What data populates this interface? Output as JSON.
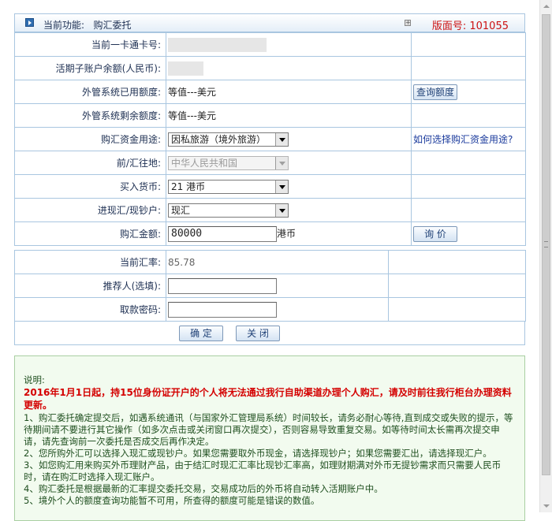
{
  "header": {
    "function_label": "当前功能:",
    "function_name": "购汇委托",
    "page_number_label": "版面号:",
    "page_number": "101055"
  },
  "form": {
    "card_no_label": "当前一卡通卡号:",
    "balance_label": "活期子账户余额(人民币):",
    "used_quota_label": "外管系统已用额度:",
    "used_quota_value": "等值---美元",
    "query_quota_button": "查询额度",
    "remaining_quota_label": "外管系统剩余额度:",
    "remaining_quota_value": "等值---美元",
    "purpose_label": "购汇资金用途:",
    "purpose_value": "因私旅游（境外旅游）",
    "purpose_help_link": "如何选择购汇资金用途?",
    "destination_label": "前/汇往地:",
    "destination_value": "中华人民共和国",
    "currency_label": "买入货币:",
    "currency_value": "21 港币",
    "cash_type_label": "进现汇/现钞户:",
    "cash_type_value": "现汇",
    "amount_label": "购汇金额:",
    "amount_value": "80000",
    "amount_unit": "港币",
    "price_button": "询 价",
    "rate_label": "当前汇率:",
    "rate_value": "85.78",
    "referrer_label": "推荐人(选填):",
    "referrer_value": "",
    "password_label": "取款密码:",
    "password_value": "",
    "confirm_button": "确 定",
    "close_button": "关 闭"
  },
  "notes": {
    "title": "说明:",
    "alert": "2016年1月1日起，持15位身份证开户的个人将无法通过我行自助渠道办理个人购汇，请及时前往我行柜台办理资料更新。",
    "items": [
      "1、购汇委托确定提交后，如遇系统通讯（与国家外汇管理局系统）时间较长，请务必耐心等待,直到成交或失败的提示，等待期间请不要进行其它操作（如多次点击或关闭窗口再次提交），否则容易导致重复交易。如等待时间太长需再次提交申请，请先查询前一次委托是否成交后再作决定。",
      "2、您所购外汇可以选择入现汇或现钞户。如果您需要取外币现金，请选择现钞户；如果您需要汇出，请选择现汇户。",
      "3、如您购汇用来购买外币理财产品，由于结汇时现汇汇率比现钞汇率高，如理财期满对外币无提钞需求而只需要人民币时，请在购汇时选择入现汇账户。",
      "4、购汇委托是根据最新的汇率提交委托交易，交易成功后的外币将自动转入活期账户中。",
      "5、境外个人的额度查询功能暂不可用，所查得的额度可能是错误的数值。"
    ]
  },
  "colors": {
    "border": "#a9c6e0",
    "alert": "#d40000",
    "page_number": "#cc1111",
    "notes_bg": "#f2fbef"
  }
}
